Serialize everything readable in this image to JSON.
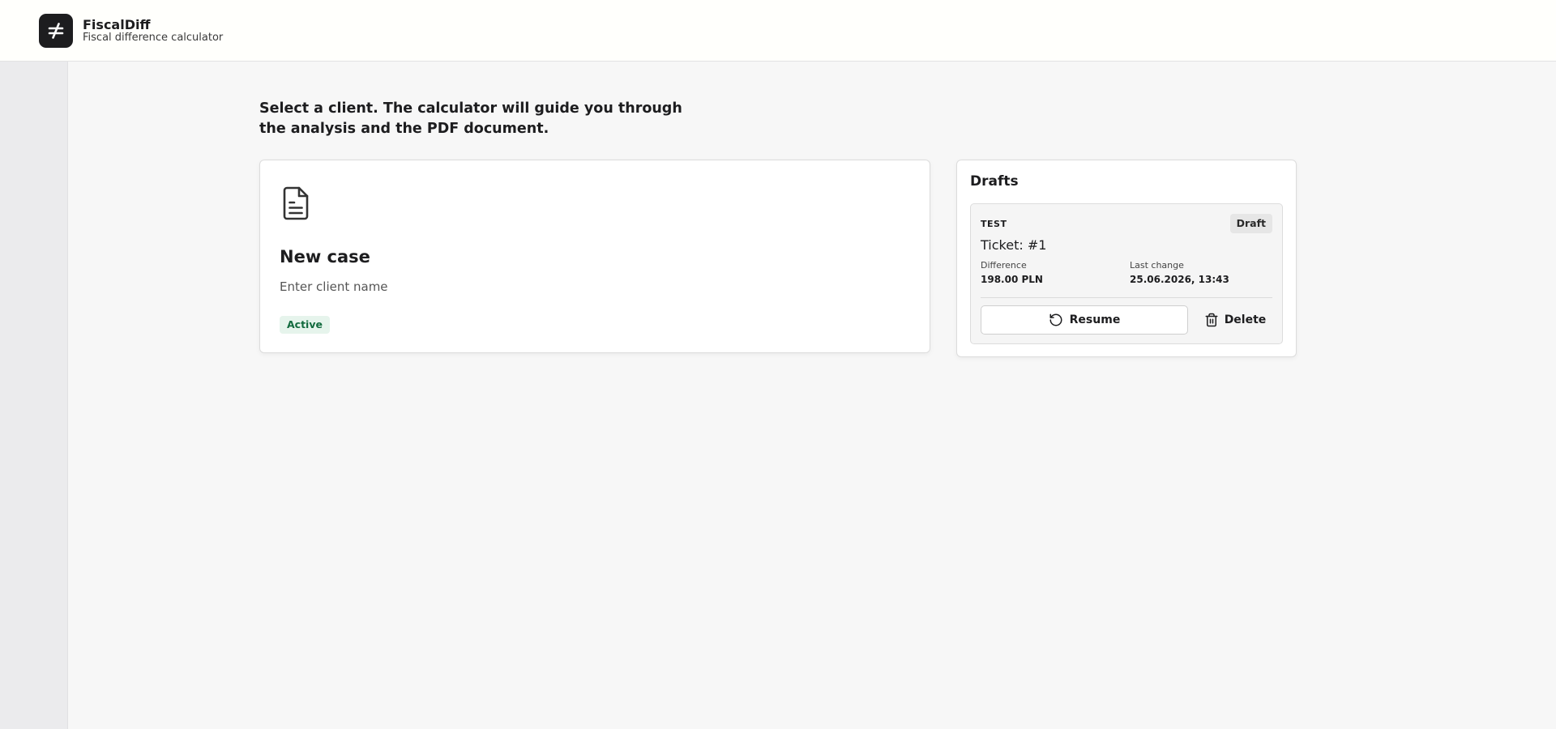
{
  "header": {
    "logo_icon": "not-equal-icon",
    "title": "FiscalDiff",
    "subtitle": "Fiscal difference calculator"
  },
  "intro": {
    "text": "Select a client. The calculator will guide you through the analysis and the PDF document."
  },
  "new_case": {
    "icon": "document-icon",
    "title": "New case",
    "subtitle": "Enter client name",
    "status": "Active"
  },
  "drafts": {
    "title": "Drafts",
    "items": [
      {
        "client": "TEST",
        "badge": "Draft",
        "ticket": "Ticket: #1",
        "difference_label": "Difference",
        "difference_value": "198.00 PLN",
        "last_change_label": "Last change",
        "last_change_value": "25.06.2026, 13:43",
        "resume_label": "Resume",
        "resume_icon": "rotate-ccw-icon",
        "delete_label": "Delete",
        "delete_icon": "trash-icon"
      }
    ]
  },
  "colors": {
    "page_bg": "#f7f7f7",
    "topbar_bg": "#fffffc",
    "sidebar_bg": "#ebebed",
    "logo_bg": "#1d1d1f",
    "active_badge_bg": "#e6f4ec",
    "active_badge_text": "#126b3e"
  }
}
